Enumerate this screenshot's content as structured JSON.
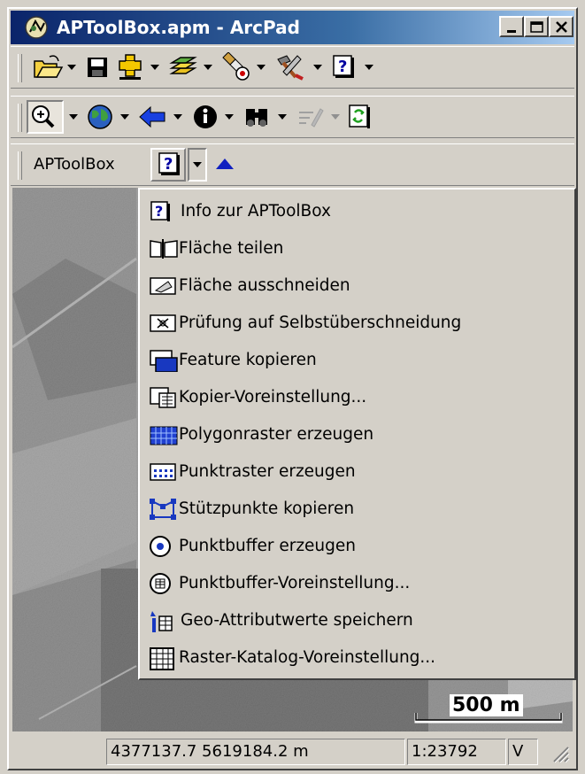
{
  "window": {
    "title": "APToolBox.apm - ArcPad"
  },
  "toolbar3": {
    "label": "APToolBox"
  },
  "menu": {
    "items": [
      {
        "label": "Info zur APToolBox",
        "icon": "help-icon"
      },
      {
        "label": "Fläche teilen",
        "icon": "split-polygon-icon"
      },
      {
        "label": "Fläche ausschneiden",
        "icon": "cut-polygon-icon"
      },
      {
        "label": "Prüfung auf Selbstüberschneidung",
        "icon": "self-intersection-check-icon"
      },
      {
        "label": "Feature kopieren",
        "icon": "copy-feature-icon"
      },
      {
        "label": "Kopier-Voreinstellung...",
        "icon": "copy-settings-icon"
      },
      {
        "label": "Polygonraster erzeugen",
        "icon": "polygon-raster-icon"
      },
      {
        "label": "Punktraster erzeugen",
        "icon": "point-raster-icon"
      },
      {
        "label": "Stützpunkte kopieren",
        "icon": "copy-vertices-icon"
      },
      {
        "label": "Punktbuffer erzeugen",
        "icon": "point-buffer-icon"
      },
      {
        "label": "Punktbuffer-Voreinstellung...",
        "icon": "point-buffer-settings-icon"
      },
      {
        "label": "Geo-Attributwerte speichern",
        "icon": "save-geo-attributes-icon"
      },
      {
        "label": "Raster-Katalog-Voreinstellung...",
        "icon": "raster-catalog-settings-icon"
      }
    ]
  },
  "map": {
    "scale_label": "500 m"
  },
  "statusbar": {
    "coordinates": "4377137.7 5619184.2 m",
    "scale": "1:23792",
    "mode": "V"
  },
  "colors": {
    "titlebar_start": "#0a246a",
    "titlebar_end": "#a6caf0",
    "face": "#d4d0c8"
  }
}
